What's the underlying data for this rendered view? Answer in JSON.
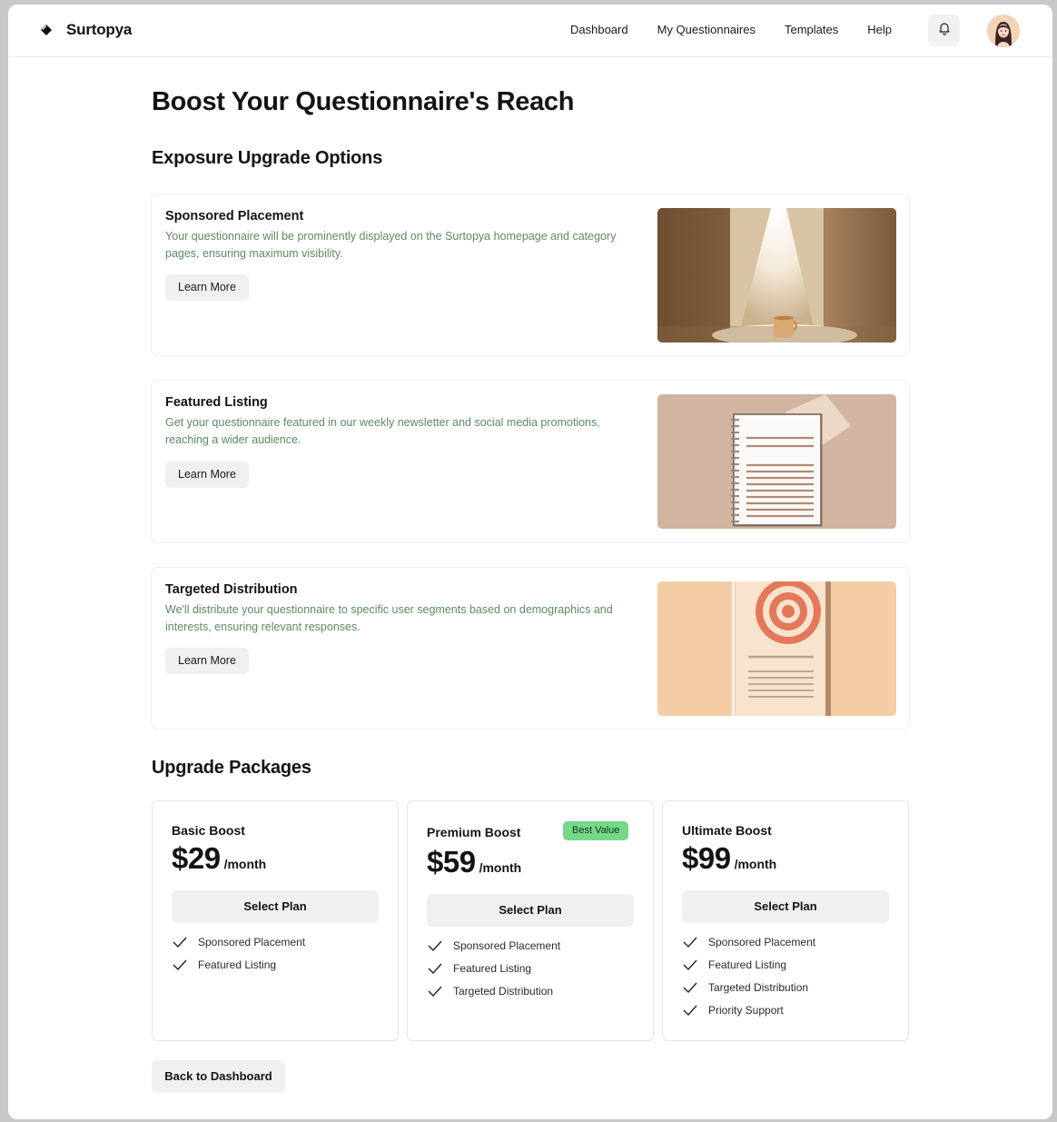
{
  "header": {
    "brand": "Surtopya",
    "nav": [
      "Dashboard",
      "My Questionnaires",
      "Templates",
      "Help"
    ]
  },
  "page": {
    "title": "Boost Your Questionnaire's Reach",
    "options_heading": "Exposure Upgrade Options",
    "packages_heading": "Upgrade Packages",
    "back_label": "Back to Dashboard"
  },
  "options": [
    {
      "title": "Sponsored Placement",
      "desc": "Your questionnaire will be prominently displayed on the Surtopya homepage and category pages, ensuring maximum visibility.",
      "button": "Learn More",
      "image": "spotlight-coffee-cup"
    },
    {
      "title": "Featured Listing",
      "desc": "Get your questionnaire featured in our weekly newsletter and social media promotions, reaching a wider audience.",
      "button": "Learn More",
      "image": "spiral-notebook"
    },
    {
      "title": "Targeted Distribution",
      "desc": "We'll distribute your questionnaire to specific user segments based on demographics and interests, ensuring relevant responses.",
      "button": "Learn More",
      "image": "target-document"
    }
  ],
  "packages": [
    {
      "name": "Basic Boost",
      "price": "$29",
      "period": "/month",
      "button": "Select Plan",
      "features": [
        "Sponsored Placement",
        "Featured Listing"
      ]
    },
    {
      "name": "Premium Boost",
      "badge": "Best Value",
      "price": "$59",
      "period": "/month",
      "button": "Select Plan",
      "features": [
        "Sponsored Placement",
        "Featured Listing",
        "Targeted Distribution"
      ]
    },
    {
      "name": "Ultimate Boost",
      "price": "$99",
      "period": "/month",
      "button": "Select Plan",
      "features": [
        "Sponsored Placement",
        "Featured Listing",
        "Targeted Distribution",
        "Priority Support"
      ]
    }
  ],
  "colors": {
    "accent_text": "#5c8a63",
    "badge": "#73d88a",
    "button_bg": "#f0f0f0"
  },
  "icons": {
    "brand": "diamond-logo-icon",
    "notification": "bell-icon",
    "feature": "check-icon"
  }
}
